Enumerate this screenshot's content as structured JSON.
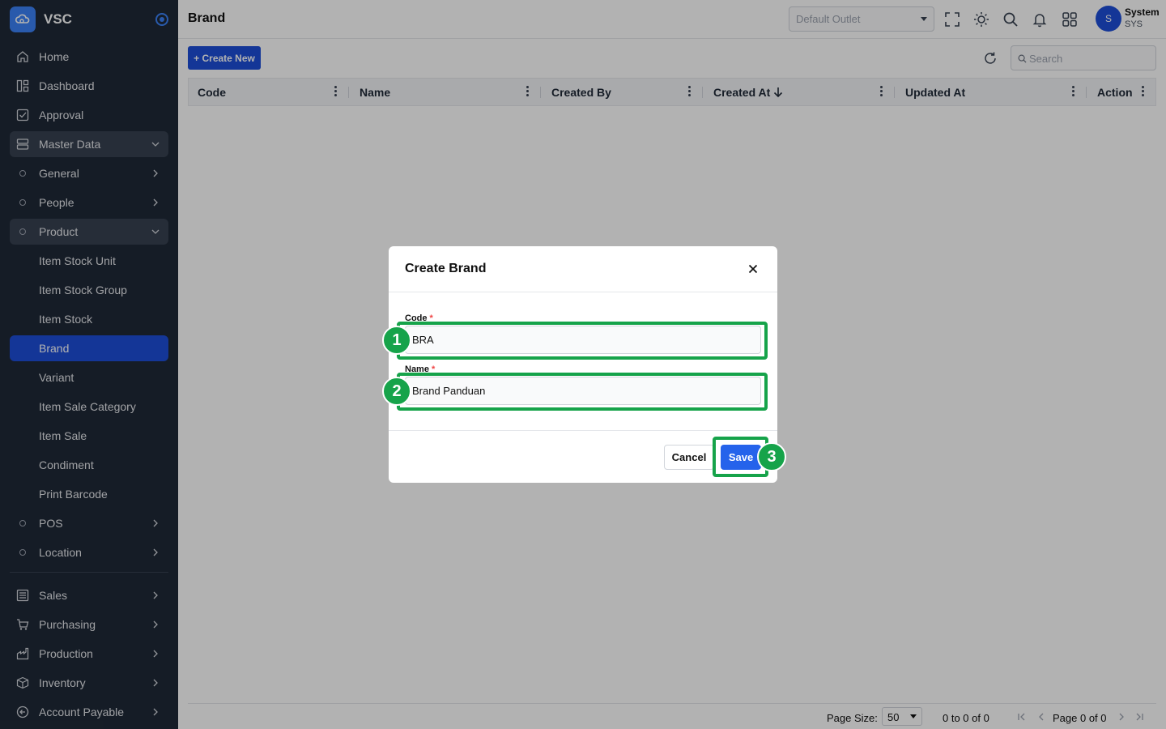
{
  "app": {
    "name": "VSC"
  },
  "sidebar": {
    "items": [
      {
        "label": "Home",
        "icon": "home-icon"
      },
      {
        "label": "Dashboard",
        "icon": "dashboard-icon"
      },
      {
        "label": "Approval",
        "icon": "checkbox-icon"
      },
      {
        "label": "Master Data",
        "icon": "database-icon"
      },
      {
        "label": "General"
      },
      {
        "label": "People"
      },
      {
        "label": "Product"
      },
      {
        "label": "Item Stock Unit"
      },
      {
        "label": "Item Stock Group"
      },
      {
        "label": "Item Stock"
      },
      {
        "label": "Brand"
      },
      {
        "label": "Variant"
      },
      {
        "label": "Item Sale Category"
      },
      {
        "label": "Item Sale"
      },
      {
        "label": "Condiment"
      },
      {
        "label": "Print Barcode"
      },
      {
        "label": "POS"
      },
      {
        "label": "Location"
      },
      {
        "label": "Sales",
        "icon": "list-icon"
      },
      {
        "label": "Purchasing",
        "icon": "cart-icon"
      },
      {
        "label": "Production",
        "icon": "factory-icon"
      },
      {
        "label": "Inventory",
        "icon": "box-icon"
      },
      {
        "label": "Account Payable",
        "icon": "arrow-circle-icon"
      }
    ]
  },
  "header": {
    "title": "Brand",
    "outlet_placeholder": "Default Outlet",
    "user": {
      "initial": "S",
      "name": "System",
      "role": "SYS"
    }
  },
  "toolbar": {
    "create_label": "+ Create New",
    "search_placeholder": "Search"
  },
  "table": {
    "columns": [
      "Code",
      "Name",
      "Created By",
      "Created At",
      "Updated At",
      "Action"
    ],
    "sorted_column": "Created At",
    "sort_direction": "descending"
  },
  "footer": {
    "page_size_label": "Page Size:",
    "page_size": "50",
    "range_text": "0 to 0 of 0",
    "page_text": "Page 0 of 0"
  },
  "modal": {
    "title": "Create Brand",
    "code_label": "Code",
    "code_value": "BRA",
    "name_label": "Name",
    "name_value": "Brand Panduan",
    "required_mark": "*",
    "cancel_label": "Cancel",
    "save_label": "Save"
  },
  "annotations": [
    "1",
    "2",
    "3"
  ],
  "colors": {
    "sidebar_bg": "#1f2937",
    "accent": "#1d4ed8",
    "save_button": "#2563eb",
    "highlight": "#16a34a"
  }
}
